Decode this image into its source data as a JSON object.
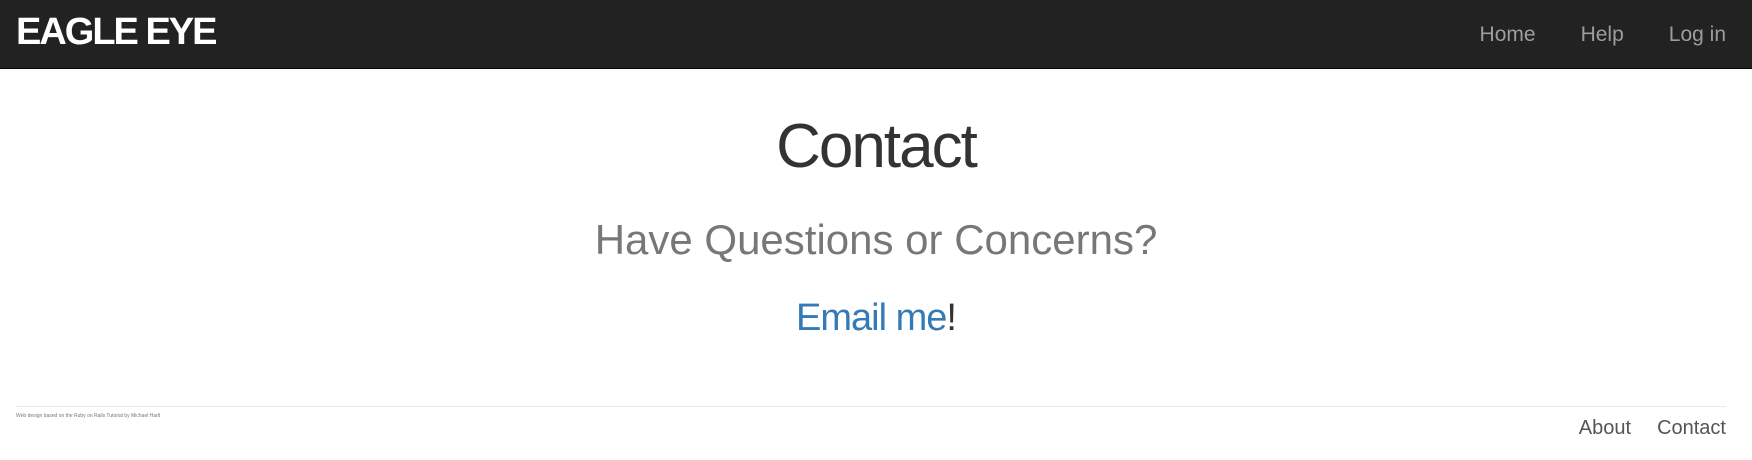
{
  "navbar": {
    "logo": "EAGLE EYE",
    "links": [
      {
        "label": "Home"
      },
      {
        "label": "Help"
      },
      {
        "label": "Log in"
      }
    ]
  },
  "main": {
    "title": "Contact",
    "subtitle": "Have Questions or Concerns?",
    "email_link": "Email me",
    "email_suffix": "!"
  },
  "footer": {
    "credit": "Web design based on the Ruby on Rails Tutorial by Michael Hartl",
    "links": [
      {
        "label": "About"
      },
      {
        "label": "Contact"
      }
    ]
  },
  "colors": {
    "navbar_bg": "#222222",
    "link_blue": "#337ab7",
    "muted_text": "#777777"
  }
}
